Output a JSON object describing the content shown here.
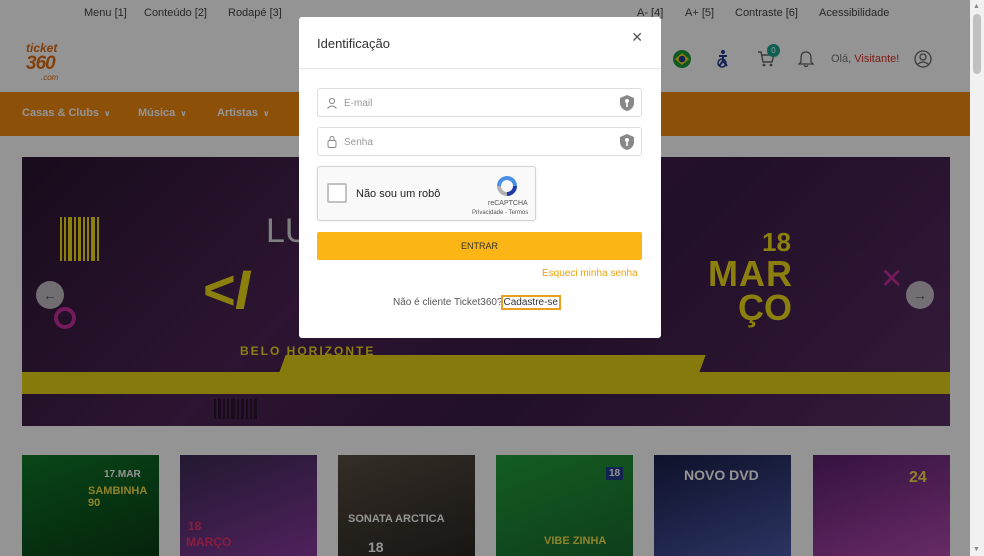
{
  "accessibility_bar": {
    "menu": "Menu [1]",
    "content": "Conteúdo [2]",
    "footer": "Rodapé [3]",
    "font_decrease": "A- [4]",
    "font_increase": "A+ [5]",
    "contrast": "Contraste [6]",
    "accessibility": "Acessibilidade"
  },
  "header": {
    "logo_line1": "ticket",
    "logo_line2": "360",
    "logo_line3": ".com",
    "cart_count": "0",
    "greeting_prefix": "Olá,",
    "greeting_name": "Visitante!",
    "icons": [
      "brazil-flag-icon",
      "accessibility-icon",
      "cart-icon",
      "bell-icon",
      "user-icon"
    ]
  },
  "nav": {
    "items": [
      {
        "label": "Casas & Clubs"
      },
      {
        "label": "Música"
      },
      {
        "label": "Artistas"
      }
    ]
  },
  "banner": {
    "date_day": "18",
    "date_month_1": "MAR",
    "date_month_2": "ÇO",
    "city": "BELO HORIZONTE",
    "title_partial_1": "LU",
    "title_partial_2": "<I"
  },
  "thumbnails": [
    {
      "text": "SAMBINHA 90",
      "sub": "17.MAR"
    },
    {
      "text": "MARÇO",
      "sub": "18"
    },
    {
      "text": "SONATA ARCTICA",
      "sub": "18"
    },
    {
      "text": "VIBE ZINHA",
      "sub": "18"
    },
    {
      "text": "NOVO DVD",
      "sub": ""
    },
    {
      "text": "24",
      "sub": ""
    }
  ],
  "modal": {
    "title": "Identificação",
    "email_placeholder": "E-mail",
    "password_placeholder": "Senha",
    "captcha_label": "Não sou um robô",
    "captcha_brand": "reCAPTCHA",
    "captcha_terms": "Privacidade - Termos",
    "submit_label": "ENTRAR",
    "forgot_label": "Esqueci minha senha",
    "register_prompt": "Não é cliente Ticket360?",
    "register_link": "Cadastre-se"
  },
  "colors": {
    "brand_orange": "#f38b11",
    "button_yellow": "#fbb514",
    "link_yellow": "#f0a30a",
    "banner_yellow": "#f0dc18"
  }
}
